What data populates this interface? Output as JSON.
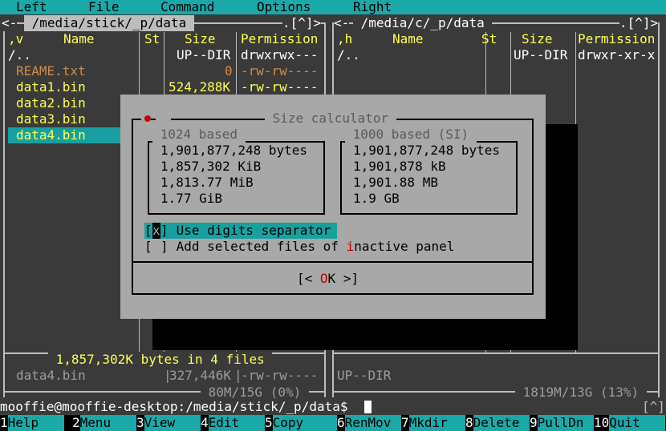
{
  "menu": [
    "Left",
    "File",
    "Command",
    "Options",
    "Right"
  ],
  "left_panel": {
    "path": " /media/stick/_p/data ",
    "path_right": ".[^]>",
    "prefix": "<-",
    "sort_indicator": ",v",
    "columns": [
      "Name",
      "St",
      "Size",
      "Permission"
    ],
    "files": [
      {
        "name": "/..",
        "size": "UP--DIR",
        "perm": "drwxrwx---"
      },
      {
        "name": "REAME.txt",
        "size": "0",
        "perm": "-rw-rw----"
      },
      {
        "name": "data1.bin",
        "size": "524,288K",
        "perm": "-rw-rw----"
      },
      {
        "name": "data2.bin",
        "size": "",
        "perm": ""
      },
      {
        "name": "data3.bin",
        "size": "",
        "perm": ""
      },
      {
        "name": "data4.bin",
        "size": "",
        "perm": ""
      }
    ],
    "selection_summary": " 1,857,302K bytes in 4 files ",
    "status_name": "data4.bin",
    "status_size": "327,446K",
    "status_perm": "-rw-rw----",
    "disk_info": " 80M/15G (0%) "
  },
  "right_panel": {
    "path": " /media/c/_p/data ",
    "path_right": ".[^]>",
    "prefix": "<-",
    "sort_indicator": ",h",
    "columns": [
      "Name",
      "St",
      "Size",
      "Permission"
    ],
    "files": [
      {
        "name": "/..",
        "size": "UP--DIR",
        "perm": "drwxr-xr-x"
      }
    ],
    "status_text": "UP--DIR",
    "disk_info": " 1819M/13G (13%) "
  },
  "dialog": {
    "title": " Size calculator ",
    "group_1024": {
      "title": " 1024 based ",
      "lines": [
        "1,901,877,248 bytes",
        "1,857,302 KiB",
        "1,813.77 MiB",
        "1.77 GiB"
      ]
    },
    "group_1000": {
      "title": " 1000 based (SI) ",
      "lines": [
        "1,901,877,248 bytes",
        "1,901,878 kB",
        "1,901.88 MB",
        "1.9 GB"
      ]
    },
    "checkbox_digits": {
      "label": " Use digits separator",
      "checked": "x"
    },
    "checkbox_inactive": {
      "label_pre": " Add selected files of ",
      "label_hot": "i",
      "label_post": "nactive panel",
      "checked": " "
    },
    "ok_button": {
      "pre": "[< ",
      "hot": "O",
      "post": "K >]"
    }
  },
  "command_line": {
    "prompt": "mooffie@mooffie-desktop:/media/stick/_p/data$",
    "right_marker": "[^]"
  },
  "function_keys": [
    {
      "num": "1",
      "label": "Help"
    },
    {
      "num": "2",
      "label": "Menu"
    },
    {
      "num": "3",
      "label": "View"
    },
    {
      "num": "4",
      "label": "Edit"
    },
    {
      "num": "5",
      "label": "Copy"
    },
    {
      "num": "6",
      "label": "RenMov"
    },
    {
      "num": "7",
      "label": "Mkdir"
    },
    {
      "num": "8",
      "label": "Delete"
    },
    {
      "num": "9",
      "label": "PullDn"
    },
    {
      "num": "10",
      "label": "Quit"
    }
  ],
  "colors": {
    "accent": "#1ba8a8",
    "panel_bg": "#3a3a3a",
    "dialog_bg": "#a8a8a8",
    "highlight": "#ffff55",
    "hotkey": "#c00000"
  }
}
